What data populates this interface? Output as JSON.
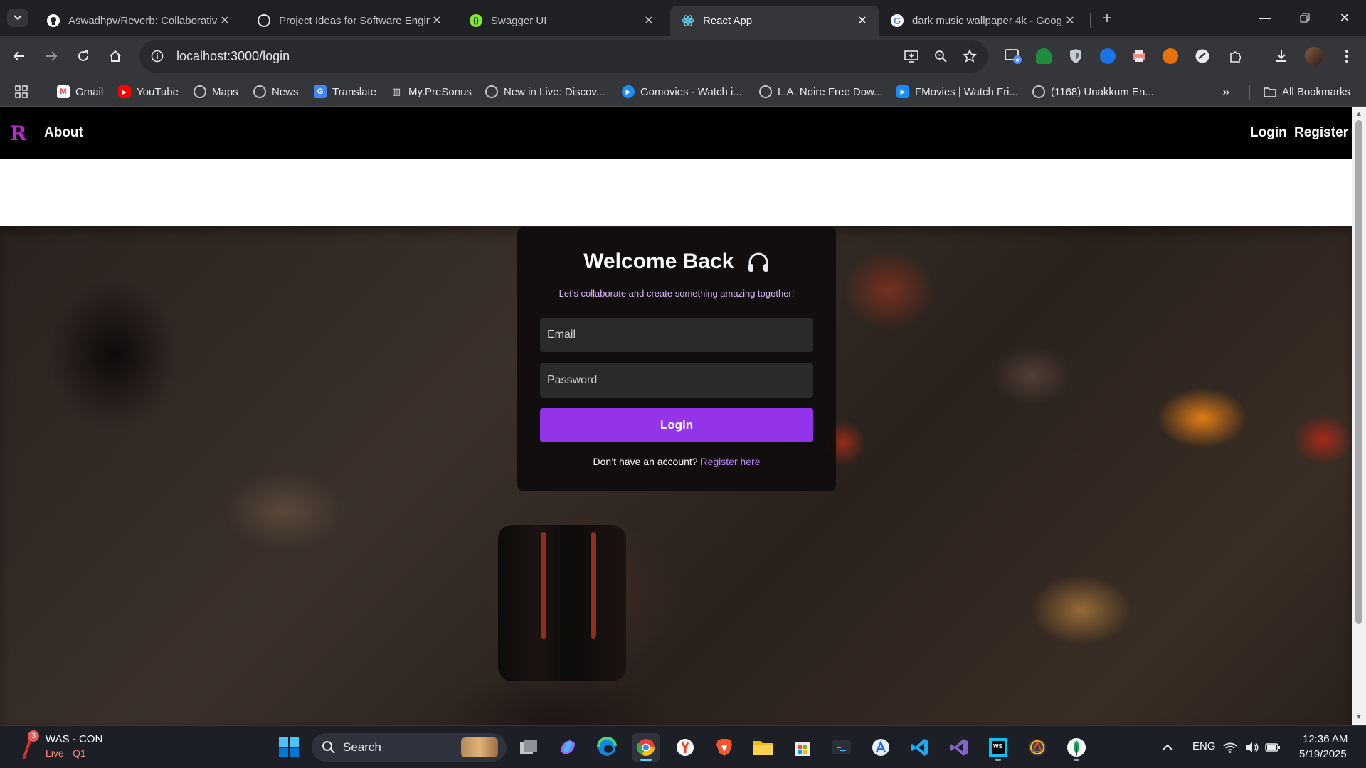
{
  "browser": {
    "tabs": [
      {
        "title": "Aswadhpv/Reverb: Collaborativ",
        "icon": "github-icon",
        "active": false
      },
      {
        "title": "Project Ideas for Software Engin",
        "icon": "chatgpt-icon",
        "active": false
      },
      {
        "title": "Swagger UI",
        "icon": "swagger-icon",
        "active": false
      },
      {
        "title": "React App",
        "icon": "react-icon",
        "active": true
      },
      {
        "title": "dark music wallpaper 4k - Goog",
        "icon": "google-icon",
        "active": false
      }
    ],
    "url": "localhost:3000/login",
    "bookmarks": [
      {
        "label": "Gmail",
        "icon": "gmail-icon"
      },
      {
        "label": "YouTube",
        "icon": "youtube-icon"
      },
      {
        "label": "Maps",
        "icon": "globe-icon"
      },
      {
        "label": "News",
        "icon": "globe-icon"
      },
      {
        "label": "Translate",
        "icon": "translate-icon"
      },
      {
        "label": "My.PreSonus",
        "icon": "presonus-icon"
      },
      {
        "label": "New in Live: Discov...",
        "icon": "globe-icon"
      },
      {
        "label": "Gomovies - Watch i...",
        "icon": "gomovies-icon"
      },
      {
        "label": "L.A. Noire Free Dow...",
        "icon": "globe-icon"
      },
      {
        "label": "FMovies | Watch Fri...",
        "icon": "fmovies-icon"
      },
      {
        "label": "(1168) Unakkum En...",
        "icon": "globe-icon"
      }
    ],
    "all_bookmarks": "All Bookmarks"
  },
  "app": {
    "brand": "R",
    "nav": {
      "about": "About",
      "login": "Login",
      "register": "Register"
    },
    "card": {
      "title": "Welcome Back",
      "subtitle": "Let’s collaborate and create something amazing together!",
      "email_placeholder": "Email",
      "password_placeholder": "Password",
      "button": "Login",
      "footer_text": "Don’t have an account?",
      "footer_link": "Register here"
    },
    "colors": {
      "accent": "#9333ea",
      "link": "#c084fc",
      "subtitle": "#d8b4fe",
      "brand": "#c026d3"
    }
  },
  "taskbar": {
    "weather_badge": "3",
    "weather_title": "WAS - CON",
    "weather_sub": "Live - Q1",
    "search": "Search",
    "lang": "ENG",
    "time": "12:36 AM",
    "date": "5/19/2025"
  }
}
